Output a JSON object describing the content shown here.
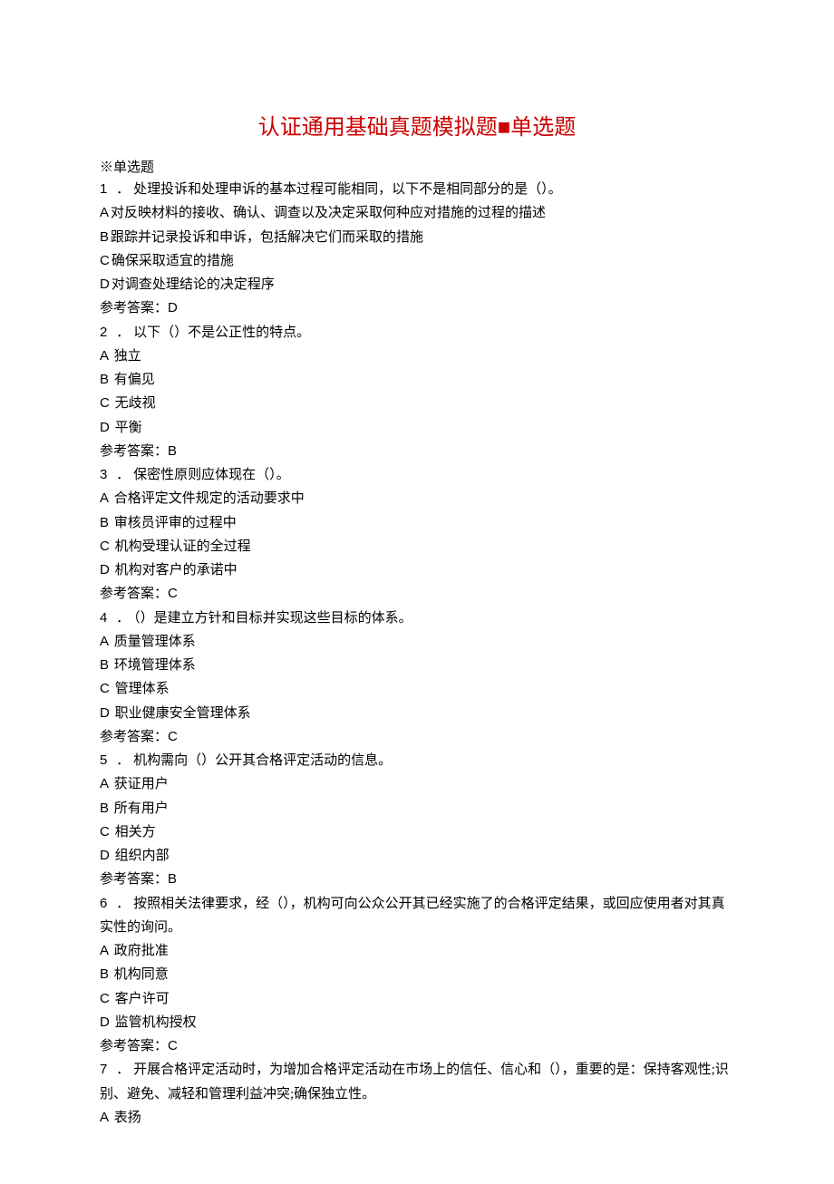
{
  "title_prefix": "认证通用基础真题模拟题",
  "title_suffix": "单选题",
  "square": "■",
  "section_marker": "※单选题",
  "answer_label": "参考答案：",
  "questions": [
    {
      "num": "1",
      "text": "处理投诉和处理申诉的基本过程可能相同，以下不是相同部分的是（）。",
      "options": [
        {
          "label": "A",
          "text": "对反映材料的接收、确认、调查以及决定采取何种应对措施的过程的描述"
        },
        {
          "label": "B",
          "text": "跟踪并记录投诉和申诉，包括解决它们而采取的措施"
        },
        {
          "label": "C",
          "text": "确保采取适宜的措施"
        },
        {
          "label": "D",
          "text": "对调查处理结论的决定程序"
        }
      ],
      "answer": "D"
    },
    {
      "num": "2",
      "text": "以下（）不是公正性的特点。",
      "options": [
        {
          "label": "A",
          "text": " 独立"
        },
        {
          "label": "B",
          "text": " 有偏见"
        },
        {
          "label": "C",
          "text": " 无歧视"
        },
        {
          "label": "D",
          "text": " 平衡"
        }
      ],
      "answer": "B"
    },
    {
      "num": "3",
      "text": "保密性原则应体现在（）。",
      "options": [
        {
          "label": "A",
          "text": " 合格评定文件规定的活动要求中"
        },
        {
          "label": "B",
          "text": " 审核员评审的过程中"
        },
        {
          "label": "C",
          "text": " 机构受理认证的全过程"
        },
        {
          "label": "D",
          "text": " 机构对客户的承诺中"
        }
      ],
      "answer": "C"
    },
    {
      "num": "4",
      "text": "（）是建立方针和目标并实现这些目标的体系。",
      "options": [
        {
          "label": "A",
          "text": " 质量管理体系"
        },
        {
          "label": "B",
          "text": " 环境管理体系"
        },
        {
          "label": "C",
          "text": " 管理体系"
        },
        {
          "label": "D",
          "text": " 职业健康安全管理体系"
        }
      ],
      "answer": "C"
    },
    {
      "num": "5",
      "text": "机构需向（）公开其合格评定活动的信息。",
      "options": [
        {
          "label": "A",
          "text": " 获证用户"
        },
        {
          "label": "B",
          "text": " 所有用户"
        },
        {
          "label": "C",
          "text": " 相关方"
        },
        {
          "label": "D",
          "text": " 组织内部"
        }
      ],
      "answer": "B"
    },
    {
      "num": "6",
      "text": "按照相关法律要求，经（），机构可向公众公开其已经实施了的合格评定结果，或回应使用者对其真实性的询问。",
      "options": [
        {
          "label": "A",
          "text": " 政府批准"
        },
        {
          "label": "B",
          "text": " 机构同意"
        },
        {
          "label": "C",
          "text": " 客户许可"
        },
        {
          "label": "D",
          "text": " 监管机构授权"
        }
      ],
      "answer": "C"
    },
    {
      "num": "7",
      "text": "开展合格评定活动时，为增加合格评定活动在市场上的信任、信心和（），重要的是：保持客观性;识别、避免、减轻和管理利益冲突;确保独立性。",
      "options": [
        {
          "label": "A",
          "text": " 表扬"
        }
      ],
      "answer": null
    }
  ]
}
